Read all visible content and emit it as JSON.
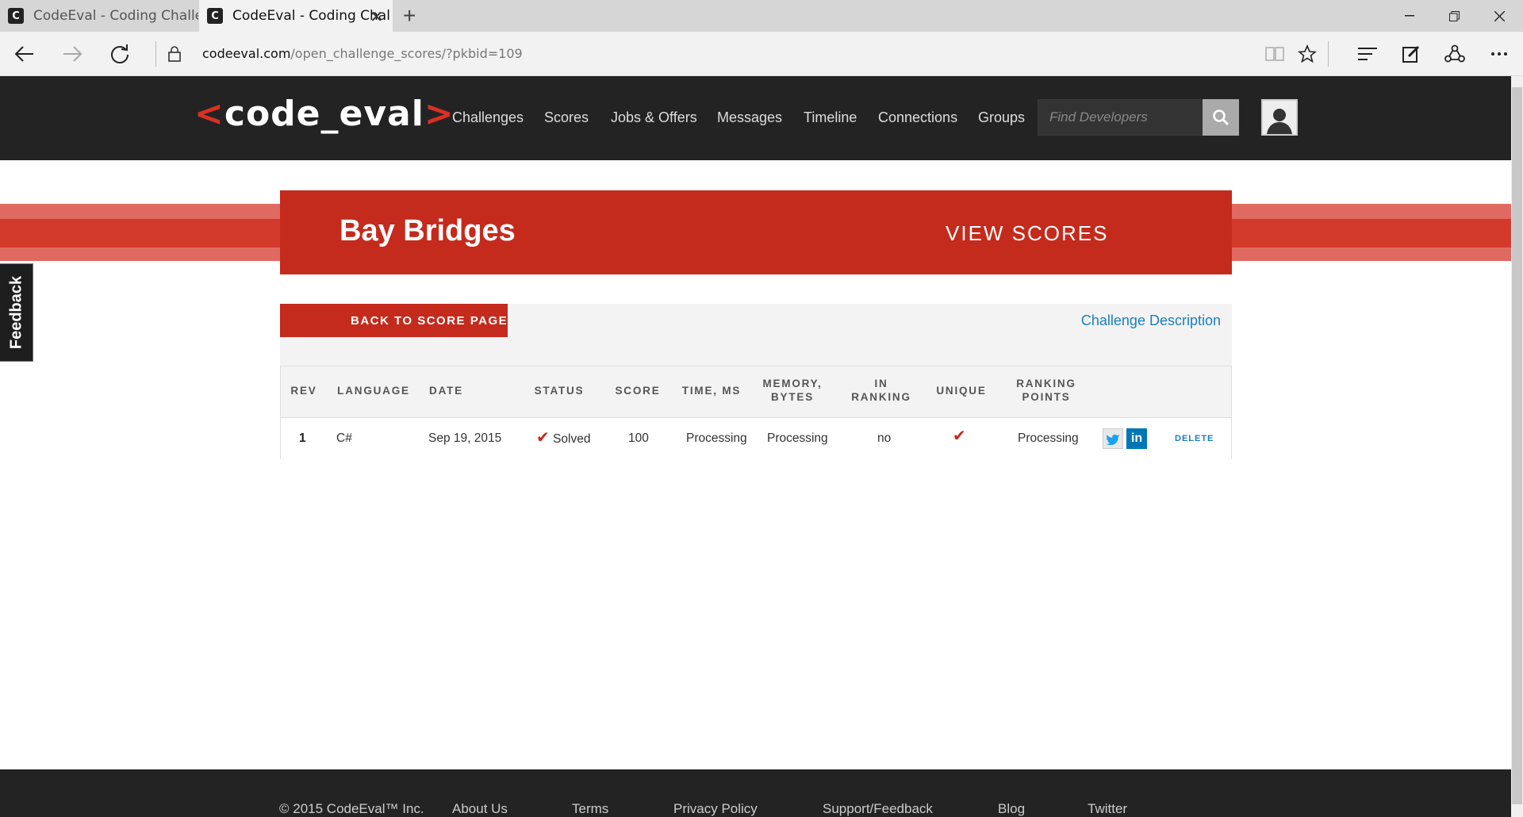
{
  "browser": {
    "tabs": [
      {
        "title": "CodeEval - Coding Challenge",
        "active": false
      },
      {
        "title": "CodeEval - Coding Chal",
        "active": true
      }
    ],
    "url_domain": "codeeval.com",
    "url_path": "/open_challenge_scores/?pkbid=109"
  },
  "site": {
    "logo_left": "<",
    "logo_text": "code_eval",
    "logo_right": ">",
    "nav": [
      "Challenges",
      "Scores",
      "Jobs & Offers",
      "Messages",
      "Timeline",
      "Connections",
      "Groups"
    ],
    "search_placeholder": "Find Developers"
  },
  "banner": {
    "title": "Bay Bridges",
    "right_label": "VIEW SCORES"
  },
  "feedback_label": "Feedback",
  "panel": {
    "back_label": "BACK TO SCORE PAGE",
    "description_link": "Challenge Description"
  },
  "table": {
    "headers": [
      "REV",
      "LANGUAGE",
      "DATE",
      "STATUS",
      "SCORE",
      "TIME, MS",
      "MEMORY, BYTES",
      "IN RANKING",
      "UNIQUE",
      "RANKING POINTS"
    ],
    "row": {
      "rev": "1",
      "language": "C#",
      "date": "Sep 19, 2015",
      "status": "Solved",
      "score": "100",
      "time": "Processing",
      "memory": "Processing",
      "in_ranking": "no",
      "ranking_points": "Processing",
      "delete_label": "DELETE"
    }
  },
  "footer": {
    "copyright": "© 2015 CodeEval™ Inc.",
    "links": [
      "About Us",
      "Terms",
      "Privacy Policy",
      "Support/Feedback",
      "Blog",
      "Twitter"
    ]
  },
  "colors": {
    "brand_red": "#c42b1c",
    "header_dark": "#232323",
    "link_blue": "#1a7fc1"
  }
}
